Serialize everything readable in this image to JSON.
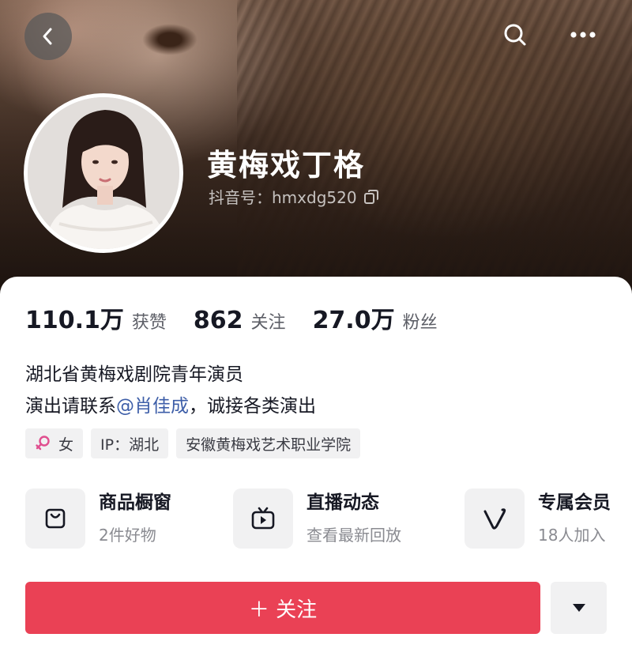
{
  "header": {
    "back_icon": "chevron-left-icon",
    "search_icon": "search-icon",
    "more_icon": "more-dots-icon"
  },
  "profile": {
    "name": "黄梅戏丁格",
    "handle": "抖音号：hmxdg520",
    "copy_icon": "copy-icon"
  },
  "stats": [
    {
      "num": "110.1万",
      "label": "获赞"
    },
    {
      "num": "862",
      "label": "关注"
    },
    {
      "num": "27.0万",
      "label": "粉丝"
    }
  ],
  "bio": {
    "line1": "湖北省黄梅戏剧院青年演员",
    "line2_prefix": "演出请联系",
    "mention": "@肖佳成",
    "line2_suffix": "，诚接各类演出"
  },
  "tags": {
    "gender": "女",
    "location": "IP：湖北",
    "school": "安徽黄梅戏艺术职业学院"
  },
  "features": [
    {
      "title": "商品橱窗",
      "sub": "2件好物",
      "icon": "shopping-bag-icon"
    },
    {
      "title": "直播动态",
      "sub": "查看最新回放",
      "icon": "tv-play-icon"
    },
    {
      "title": "专属会员",
      "sub": "18人加入",
      "icon": "v-member-icon"
    }
  ],
  "actions": {
    "follow": "＋ 关注",
    "dropdown_icon": "caret-down-icon"
  },
  "colors": {
    "follow_red": "#ea4155",
    "mention_blue": "#3d5ea8",
    "female_pink": "#e04f8f"
  }
}
